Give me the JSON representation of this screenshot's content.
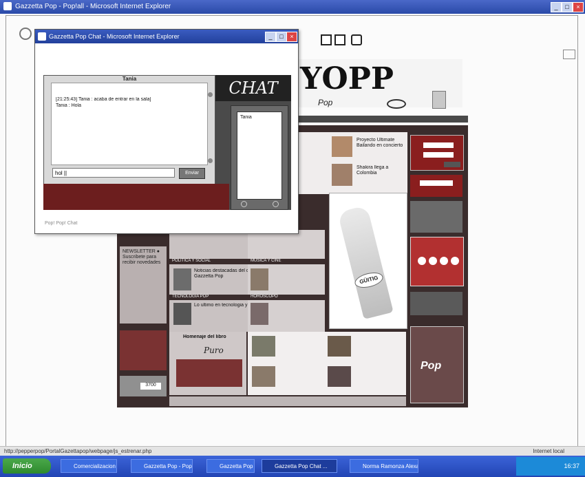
{
  "ie": {
    "title": "Gazzetta Pop - Pop!all - Microsoft Internet Explorer",
    "status_url": "http://pepperpop/PortalGazettapop/webpage/js_estrenar.php",
    "status_zone": "Internet local"
  },
  "chat": {
    "title": "Gazzetta Pop Chat - Microsoft Internet Explorer",
    "panel_title": "Tania",
    "messages": [
      "[21:25:43] Tania : acaba de entrar en la sala]",
      "Tania : Hola"
    ],
    "input_value": "hol ||",
    "send_label": "Enviar",
    "logo_text": "CHAT",
    "users": [
      "Tania"
    ],
    "footer": "Pop! Pop! Chat"
  },
  "taskbar": {
    "start_label": "Inicio",
    "tasks": [
      "Comercializacion - ...",
      "Gazzetta Pop - Pop!all",
      "Gazzetta Pop - Micro...",
      "Gazzetta Pop Chat ...",
      "Norma Ramonza Alexa"
    ],
    "clock": "16:37"
  },
  "site": {
    "box_labels": [
      "POLITICA Y SOCIAL",
      "MUSICA Y CINE",
      "TECNOLOGIA POP",
      "HOROSCOPO"
    ],
    "promo_brand": "GÜITIG",
    "guestbook_title": "Homenaje del libro",
    "guestbook_word": "Puro",
    "logo_word": "Pop"
  }
}
